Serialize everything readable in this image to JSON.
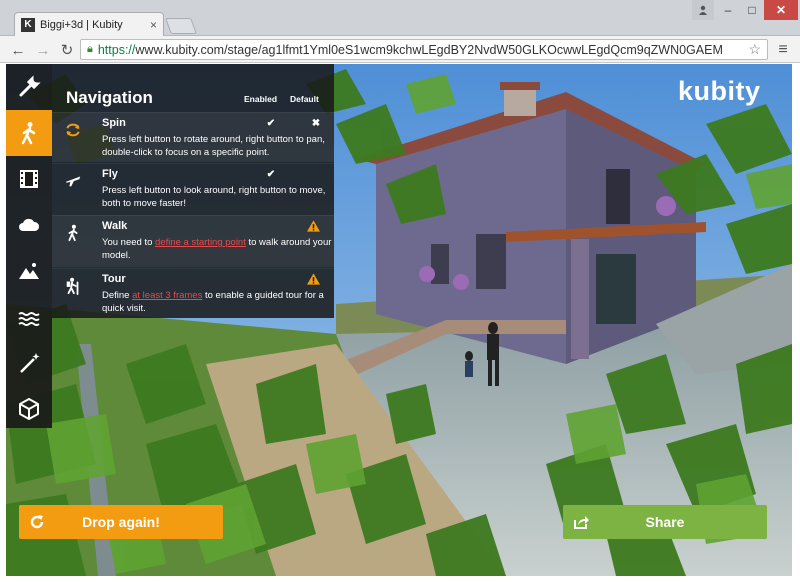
{
  "browser": {
    "tab_title": "Biggi+3d | Kubity",
    "favicon_letter": "K",
    "url_scheme": "https://",
    "url_rest": "www.kubity.com/stage/ag1lfmt1Yml0eS1wcm9kchwLEgdBY2NvdW50GLKOcwwLEgdQcm9qZWN0GAEM"
  },
  "app": {
    "logo": "kubity",
    "sidebar": [
      {
        "name": "settings",
        "icon": "wrench-icon",
        "active": false
      },
      {
        "name": "navigation",
        "icon": "walker-icon",
        "active": true
      },
      {
        "name": "film",
        "icon": "film-icon",
        "active": false
      },
      {
        "name": "sky",
        "icon": "cloud-icon",
        "active": false
      },
      {
        "name": "landscape",
        "icon": "mountain-icon",
        "active": false
      },
      {
        "name": "water",
        "icon": "water-icon",
        "active": false
      },
      {
        "name": "effects",
        "icon": "magic-wand-icon",
        "active": false
      },
      {
        "name": "object",
        "icon": "cube-icon",
        "active": false
      }
    ],
    "navigation": {
      "title": "Navigation",
      "col_enabled": "Enabled",
      "col_default": "Default",
      "modes": [
        {
          "name": "Spin",
          "icon": "rotate-icon",
          "description": "Press left button to rotate around, right button to pan, double-click to focus on a specific point.",
          "enabled": true,
          "default": true
        },
        {
          "name": "Fly",
          "icon": "plane-icon",
          "description": "Press left button to look around, right button to move, both to move faster!",
          "enabled": true,
          "default": false
        },
        {
          "name": "Walk",
          "icon": "walker-icon",
          "desc_before": "You need to ",
          "desc_link": "define a starting point",
          "desc_after": " to walk around your model.",
          "warning": true
        },
        {
          "name": "Tour",
          "icon": "hiker-icon",
          "desc_before": "Define ",
          "desc_link": "at least 3 frames",
          "desc_after": " to enable a guided tour for a quick visit.",
          "warning": true
        }
      ]
    },
    "buttons": {
      "drop": "Drop again!",
      "share": "Share"
    },
    "colors": {
      "accent": "#f39c12",
      "share": "#7cb342",
      "link": "#e84a4a"
    }
  }
}
